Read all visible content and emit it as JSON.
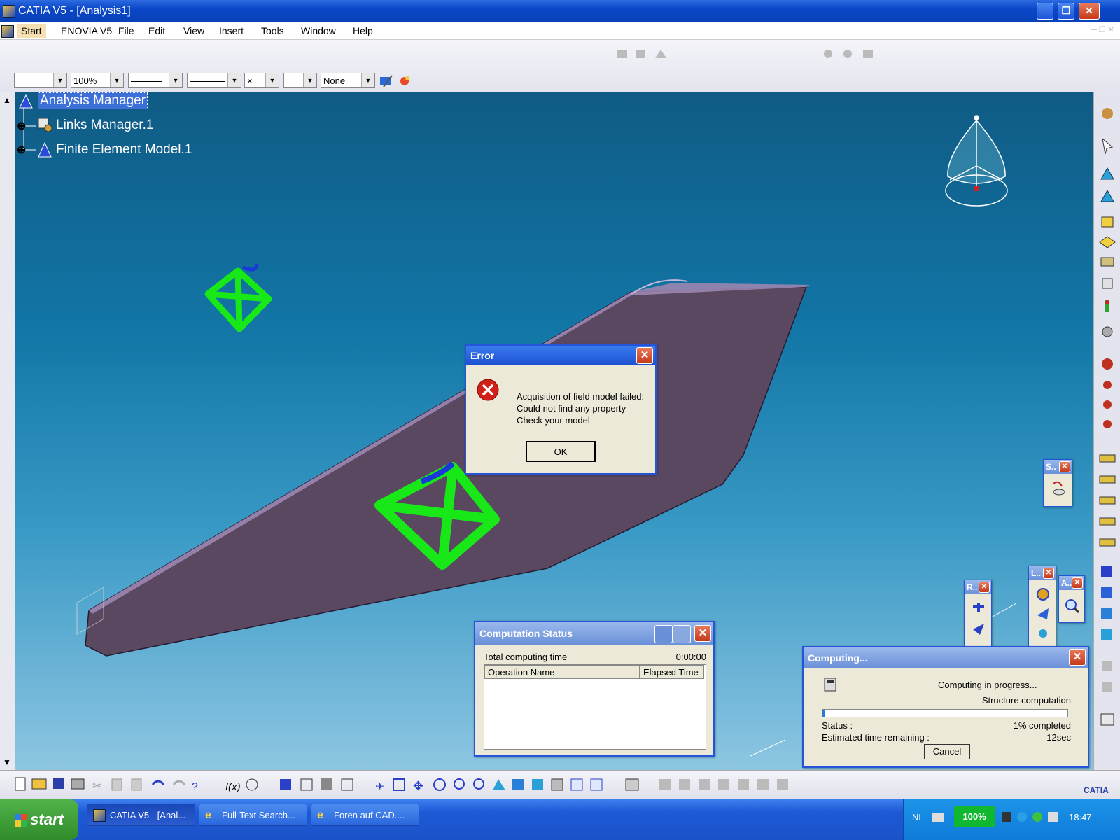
{
  "window": {
    "title": "CATIA V5 - [Analysis1]"
  },
  "menu": {
    "items": [
      "Start",
      "ENOVIA V5",
      "File",
      "Edit",
      "View",
      "Insert",
      "Tools",
      "Window",
      "Help"
    ]
  },
  "toolbar": {
    "zoom": "100%",
    "layer": "None",
    "symbol": "×"
  },
  "tree": {
    "root": "Analysis Manager",
    "children": [
      "Links Manager.1",
      "Finite Element Model.1"
    ]
  },
  "error_dialog": {
    "title": "Error",
    "lines": [
      "Acquisition of field model failed:",
      "Could not find any property",
      "Check your model"
    ],
    "ok": "OK"
  },
  "computation_status": {
    "title": "Computation Status",
    "total_label": "Total computing time",
    "total_value": "0:00:00",
    "columns": [
      "Operation Name",
      "Elapsed Time"
    ]
  },
  "computing": {
    "title": "Computing...",
    "message": "Computing in progress...",
    "task": "Structure computation",
    "progress": 0.01,
    "status_label": "Status :",
    "status_value": "1% completed",
    "remaining_label": "Estimated time remaining :",
    "remaining_value": "12sec",
    "cancel": "Cancel"
  },
  "mini_toolbars": {
    "s": "S..",
    "r": "R..",
    "l": "L..",
    "a": "A.."
  },
  "taskbar": {
    "start": "start",
    "tasks": [
      "CATIA V5 - [Anal...",
      "Full-Text Search...",
      "Foren auf CAD...."
    ],
    "lang": "NL",
    "battery": "100%",
    "clock": "18:47"
  },
  "colors": {
    "accent": "#0a46c8",
    "part": "#5a4760",
    "support": "#18e818"
  }
}
